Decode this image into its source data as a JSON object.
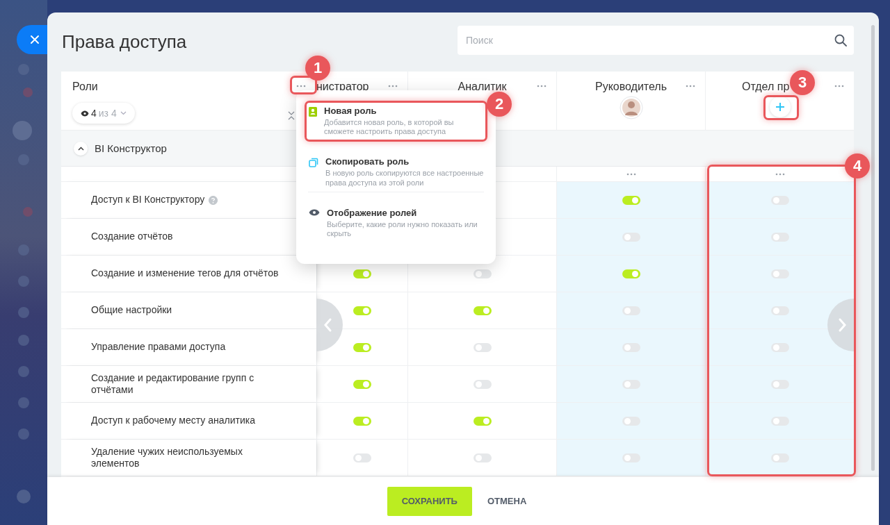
{
  "title": "Права доступа",
  "search": {
    "placeholder": "Поиск"
  },
  "roles_header": {
    "label": "Роли",
    "visible_count": "4",
    "total": "из 4"
  },
  "roles": [
    {
      "name": "нистратор",
      "kind": "clipped",
      "highlighted": false
    },
    {
      "name": "Аналитик",
      "kind": "plain",
      "highlighted": false
    },
    {
      "name": "Руководитель",
      "kind": "avatar",
      "highlighted": true
    },
    {
      "name": "Отдел пр",
      "kind": "add",
      "highlighted": true
    }
  ],
  "section": {
    "title": "BI Конструктор",
    "expanded": true
  },
  "rows": [
    {
      "label": "Доступ к BI Конструктору",
      "help": true,
      "values": [
        true,
        false
      ]
    },
    {
      "label": "Создание отчётов",
      "help": false,
      "values": [
        false,
        false
      ]
    },
    {
      "label": "Создание и изменение тегов для отчётов",
      "help": false,
      "values": [
        true,
        false,
        true,
        false
      ]
    },
    {
      "label": "Общие настройки",
      "help": false,
      "values": [
        true,
        true,
        false,
        false
      ]
    },
    {
      "label": "Управление правами доступа",
      "help": false,
      "values": [
        true,
        false,
        false,
        false
      ]
    },
    {
      "label": "Создание и редактирование групп с отчётами",
      "help": false,
      "values": [
        true,
        false,
        false,
        false
      ]
    },
    {
      "label": "Доступ к рабочему месту аналитика",
      "help": false,
      "values": [
        true,
        true,
        false,
        false
      ]
    },
    {
      "label": "Удаление чужих неиспользуемых элементов",
      "help": false,
      "values": [
        false,
        false,
        false,
        false
      ]
    }
  ],
  "menu": {
    "items": [
      {
        "kind": "new",
        "title": "Новая роль",
        "description": "Добавится новая роль, в которой вы сможете настроить права доступа"
      },
      {
        "kind": "copy",
        "title": "Скопировать роль",
        "description": "В новую роль скопируются все настроенные права доступа из этой роли"
      },
      {
        "kind": "view",
        "title": "Отображение ролей",
        "description": "Выберите, какие роли нужно показать или скрыть"
      }
    ]
  },
  "annotations": [
    {
      "number": "1"
    },
    {
      "number": "2"
    },
    {
      "number": "3"
    },
    {
      "number": "4"
    }
  ],
  "footer": {
    "save": "СОХРАНИТЬ",
    "cancel": "ОТМЕНА"
  }
}
